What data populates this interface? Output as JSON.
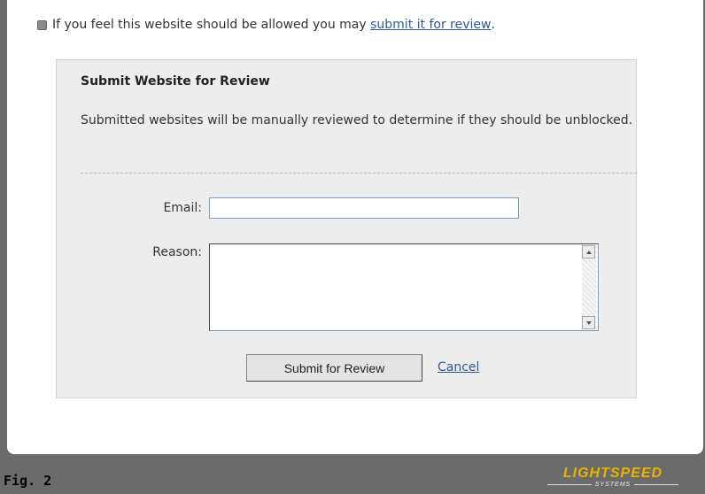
{
  "notice": {
    "text": "If you feel this website should be allowed you may ",
    "link": "submit it for review",
    "suffix": "."
  },
  "panel": {
    "title": "Submit Website for Review",
    "description": "Submitted websites will be manually reviewed to determine if they should be unblocked.",
    "email_label": "Email:",
    "email_value": "",
    "reason_label": "Reason:",
    "reason_value": "",
    "submit_label": "Submit for Review",
    "cancel_label": "Cancel"
  },
  "caption": "Fig. 2",
  "logo": {
    "name": "LIGHTSPEED",
    "sub": "SYSTEMS"
  },
  "colors": {
    "background": "#6b6b6b",
    "link": "#2b5a9c",
    "logo": "#e8b400"
  }
}
